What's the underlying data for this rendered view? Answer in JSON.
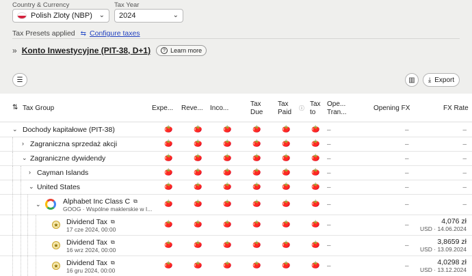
{
  "filters": {
    "country_label": "Country & Currency",
    "country_value": "Polish Zloty (NBP)",
    "year_label": "Tax Year",
    "year_value": "2024"
  },
  "presets": {
    "label": "Tax Presets applied",
    "configure_link": "Configure taxes"
  },
  "account": {
    "name": "Konto Inwestycyjne (PIT-38, D+1)",
    "learn_more": "Learn more"
  },
  "toolbar": {
    "export_label": "Export"
  },
  "columns": {
    "tax_group": "Tax Group",
    "expe": "Expe...",
    "reve": "Reve...",
    "inco": "Inco...",
    "tax_due_1": "Tax",
    "tax_due_2": "Due",
    "tax_paid_1": "Tax",
    "tax_paid_2": "Paid",
    "tax_to_1": "Tax",
    "tax_to_2": "to",
    "ope_tran_1": "Ope...",
    "ope_tran_2": "Tran...",
    "opening_fx": "Opening FX",
    "fx_rate": "FX Rate"
  },
  "dash": "–",
  "tomato_glyph": "🍅",
  "rows": [
    {
      "label": "Dochody kapitałowe (PIT-38)"
    },
    {
      "label": "Zagraniczna sprzedaż akcji"
    },
    {
      "label": "Zagraniczne dywidendy"
    },
    {
      "label": "Cayman Islands"
    },
    {
      "label": "United States"
    },
    {
      "label": "Alphabet Inc Class C",
      "sub": "GOOG · Wspólne maklerskie w I..."
    },
    {
      "label": "Dividend Tax",
      "sub": "17 cze 2024, 00:00",
      "fx": "4,076 zł",
      "fx_sub": "USD · 14.06.2024"
    },
    {
      "label": "Dividend Tax",
      "sub": "16 wrz 2024, 00:00",
      "fx": "3,8659 zł",
      "fx_sub": "USD · 13.09.2024"
    },
    {
      "label": "Dividend Tax",
      "sub": "16 gru 2024, 00:00",
      "fx": "4,0298 zł",
      "fx_sub": "USD · 13.12.2024"
    }
  ]
}
